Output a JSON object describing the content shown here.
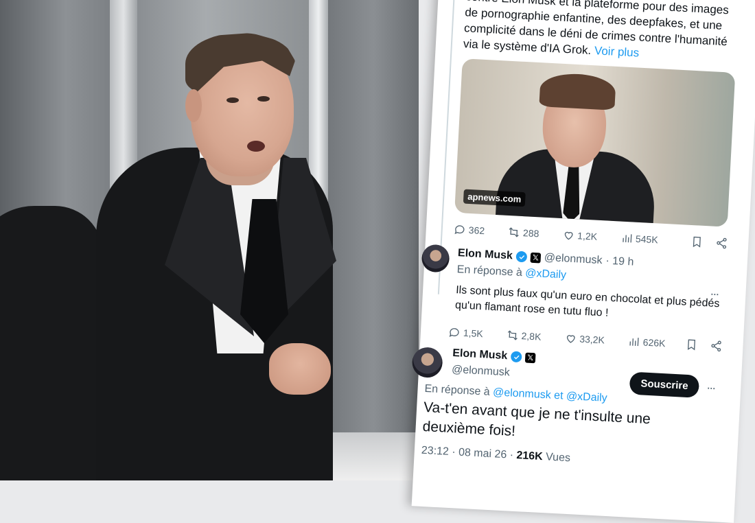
{
  "photo": {
    "background_color": "#8e9296",
    "suit_color": "#17181a"
  },
  "tweet_card": {
    "partial_text": "...contre X, cherchant à engager des poursuites contre Elon Musk et la plateforme pour des images de pornographie enfantine, des deepfakes, et une complicité dans le déni de crimes contre l'humanité via le système d'IA Grok.",
    "more_label": "Voir plus",
    "media_source": "apnews.com",
    "actions": {
      "replies": "362",
      "reposts": "288",
      "likes": "1,2K",
      "views": "545K"
    }
  },
  "reply_1": {
    "name": "Elon Musk",
    "handle": "@elonmusk",
    "time": "· 19 h",
    "reply_prefix": "En réponse à",
    "reply_to": "@xDaily",
    "text": "Ils sont plus faux qu'un euro en chocolat et plus pédés qu'un flamant rose en tutu fluo !",
    "actions": {
      "replies": "1,5K",
      "reposts": "2,8K",
      "likes": "33,2K",
      "views": "626K"
    }
  },
  "reply_2": {
    "name": "Elon Musk",
    "handle": "@elonmusk",
    "subscribe_label": "Souscrire",
    "reply_prefix": "En réponse à",
    "reply_to_1": "@elonmusk",
    "reply_joiner": "et",
    "reply_to_2": "@xDaily",
    "text": "Va-t'en avant que je ne t'insulte une deuxième fois!",
    "time": "23:12 · 08 mai 26 ·",
    "views_count": "216K",
    "views_label": "Vues"
  },
  "colors": {
    "link_blue": "#1d9bf0",
    "text_dark": "#0f1419",
    "text_gray": "#536471",
    "card_bg": "#ffffff"
  }
}
